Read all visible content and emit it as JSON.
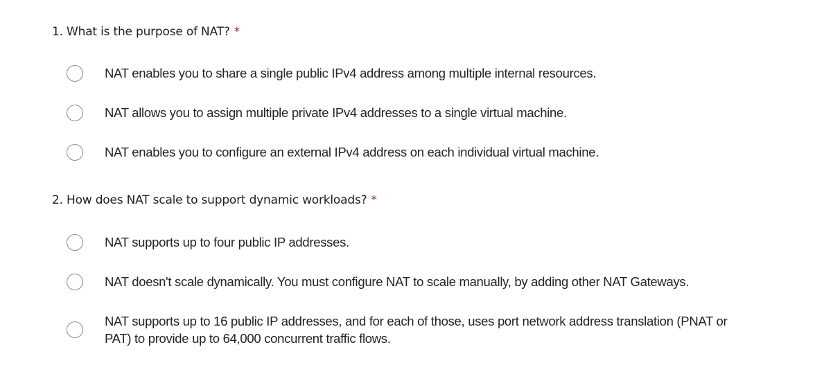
{
  "questions": [
    {
      "title": "1. What is the purpose of NAT?",
      "required": "*",
      "options": [
        "NAT enables you to share a single public IPv4 address among multiple internal resources.",
        "NAT allows you to assign multiple private IPv4 addresses to a single virtual machine.",
        "NAT enables you to configure an external IPv4 address on each individual virtual machine."
      ]
    },
    {
      "title": "2. How does NAT scale to support dynamic workloads?",
      "required": "*",
      "options": [
        "NAT supports up to four public IP addresses.",
        "NAT doesn't scale dynamically. You must configure NAT to scale manually, by adding other NAT Gateways.",
        "NAT supports up to 16 public IP addresses, and for each of those, uses port network address translation (PNAT or PAT) to provide up to 64,000 concurrent traffic flows."
      ]
    }
  ]
}
